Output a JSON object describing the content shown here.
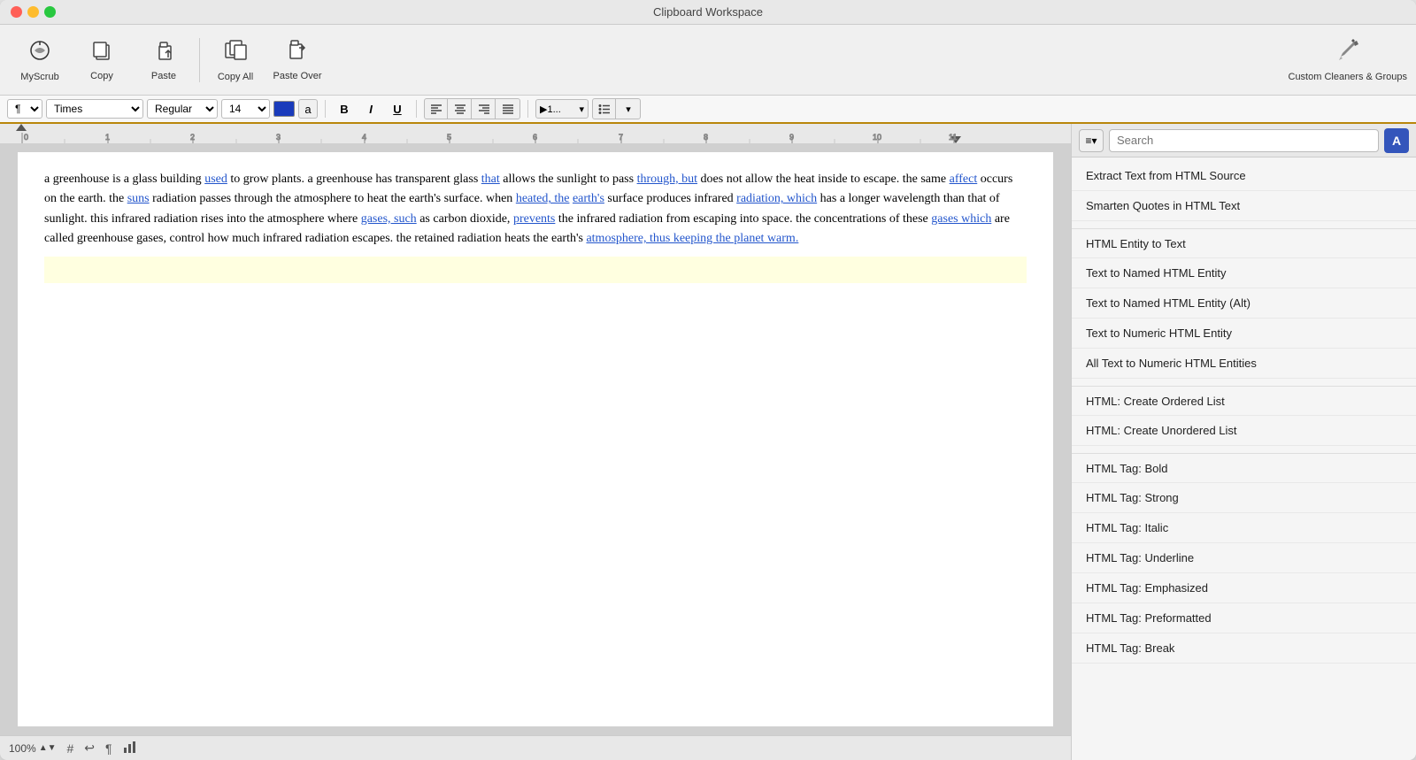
{
  "window": {
    "title": "Clipboard Workspace"
  },
  "toolbar": {
    "myscrub_label": "MyScrub",
    "copy_label": "Copy",
    "paste_label": "Paste",
    "copy_all_label": "Copy All",
    "paste_over_label": "Paste Over",
    "custom_cleaners_label": "Custom Cleaners & Groups"
  },
  "format_bar": {
    "font_family": "Times",
    "font_style": "Regular",
    "font_size": "14",
    "char_label": "a",
    "bold_label": "B",
    "italic_label": "I",
    "underline_label": "U",
    "align_left": "≡",
    "align_center": "≡",
    "align_right": "≡",
    "align_justify": "≡",
    "numbered_list": ">1...",
    "bullet_list": "≡"
  },
  "editor": {
    "content_html": "a greenhouse is a glass building <a href='#'>used</a> to grow plants. a greenhouse has transparent glass <a href='#'>that</a> allows the sunlight to pass <a href='#'>through, but</a> does not allow the heat inside to escape. the same <a href='#'>affect</a> occurs on the earth. the <a href='#'>suns</a> radiation passes through the atmosphere to heat the earth's surface. when <a href='#'>heated, the</a> <a href='#'>earth's</a> surface produces infrared <a href='#'>radiation, which</a> has a longer wavelength than that of sunlight. this infrared radiation rises into the atmosphere where <a href='#'>gases, such</a> as carbon dioxide, <a href='#'>prevents</a> the infrared radiation from escaping into space. the concentrations of these <a href='#'>gases which</a> are called greenhouse gases, control how much infrared radiation escapes. the retained radiation heats the earth's <a href='#'>atmosphere, thus keeping the planet warm.</a>"
  },
  "right_panel": {
    "search_placeholder": "Search",
    "items": [
      {
        "label": "Extract Text from HTML Source",
        "section_gap": false
      },
      {
        "label": "Smarten Quotes in HTML Text",
        "section_gap": false
      },
      {
        "label": "HTML Entity to Text",
        "section_gap": true
      },
      {
        "label": "Text to Named HTML Entity",
        "section_gap": false
      },
      {
        "label": "Text to Named HTML Entity (Alt)",
        "section_gap": false
      },
      {
        "label": "Text to Numeric HTML Entity",
        "section_gap": false
      },
      {
        "label": "All Text to Numeric HTML Entities",
        "section_gap": false
      },
      {
        "label": "HTML: Create Ordered List",
        "section_gap": true
      },
      {
        "label": "HTML: Create Unordered List",
        "section_gap": false
      },
      {
        "label": "HTML Tag: Bold",
        "section_gap": true
      },
      {
        "label": "HTML Tag: Strong",
        "section_gap": false
      },
      {
        "label": "HTML Tag: Italic",
        "section_gap": false
      },
      {
        "label": "HTML Tag: Underline",
        "section_gap": false
      },
      {
        "label": "HTML Tag: Emphasized",
        "section_gap": false
      },
      {
        "label": "HTML Tag: Preformatted",
        "section_gap": false
      },
      {
        "label": "HTML Tag: Break",
        "section_gap": false
      }
    ]
  },
  "status_bar": {
    "zoom": "100%"
  }
}
